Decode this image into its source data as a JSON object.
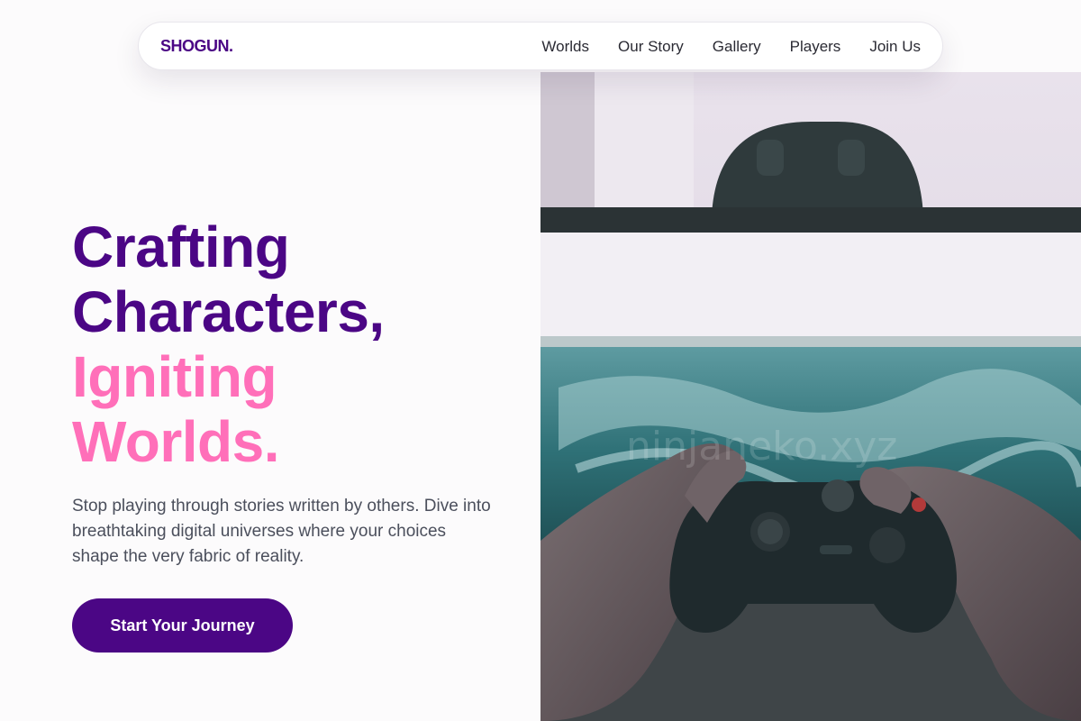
{
  "brand": {
    "logo": "SHOGUN."
  },
  "nav": {
    "items": [
      "Worlds",
      "Our Story",
      "Gallery",
      "Players",
      "Join Us"
    ]
  },
  "hero": {
    "title_line1": "Crafting",
    "title_line2": "Characters,",
    "title_line3": "Igniting",
    "title_line4": "Worlds.",
    "description": "Stop playing through stories written by others. Dive into breathtaking digital universes where your choices shape the very fabric of reality.",
    "cta_label": "Start Your Journey",
    "image_watermark": "ninjaneko.xyz"
  },
  "colors": {
    "brand_purple": "#4b0685",
    "accent_pink": "#ff6fb9",
    "body_text": "#4b4f5c",
    "background": "#fcfbfc"
  }
}
